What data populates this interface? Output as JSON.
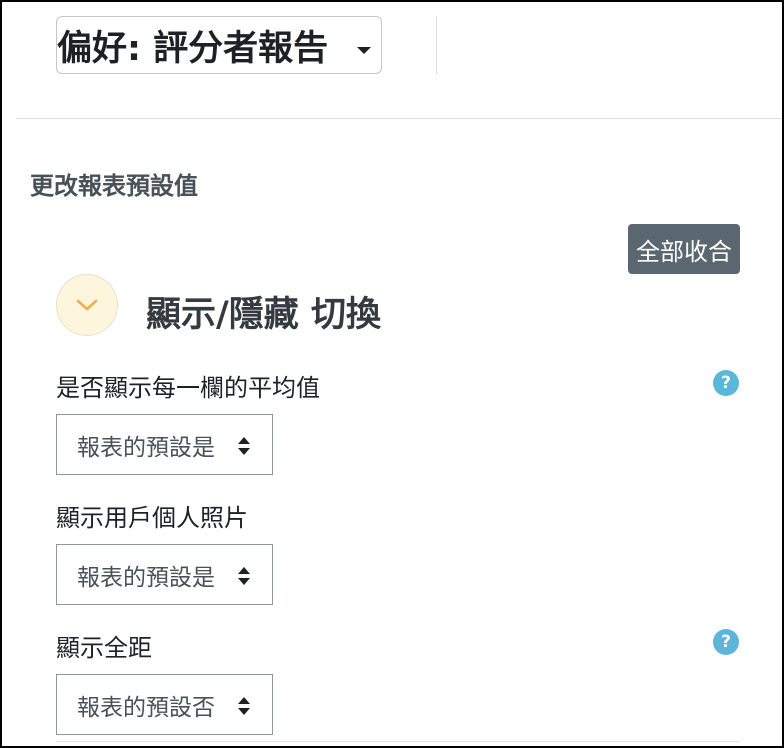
{
  "header": {
    "preferences_select": {
      "label": "偏好: 評分者報告",
      "icon": "caret-down-icon"
    }
  },
  "page": {
    "heading": "更改報表預設值"
  },
  "toolbar": {
    "collapse_all_label": "全部收合"
  },
  "section": {
    "title": "顯示/隱藏 切換",
    "toggle_icon": "chevron-down-icon",
    "toggle_color": "#f0ad4e"
  },
  "fields": [
    {
      "label": "是否顯示每一欄的平均值",
      "value": "報表的預設是",
      "has_help": true
    },
    {
      "label": "顯示用戶個人照片",
      "value": "報表的預設是",
      "has_help": false
    },
    {
      "label": "顯示全距",
      "value": "報表的預設否",
      "has_help": true
    }
  ],
  "help_icon": {
    "glyph": "?",
    "color": "#5bb6d9"
  },
  "colors": {
    "button_bg": "#5b6770",
    "text": "#1d2125"
  }
}
